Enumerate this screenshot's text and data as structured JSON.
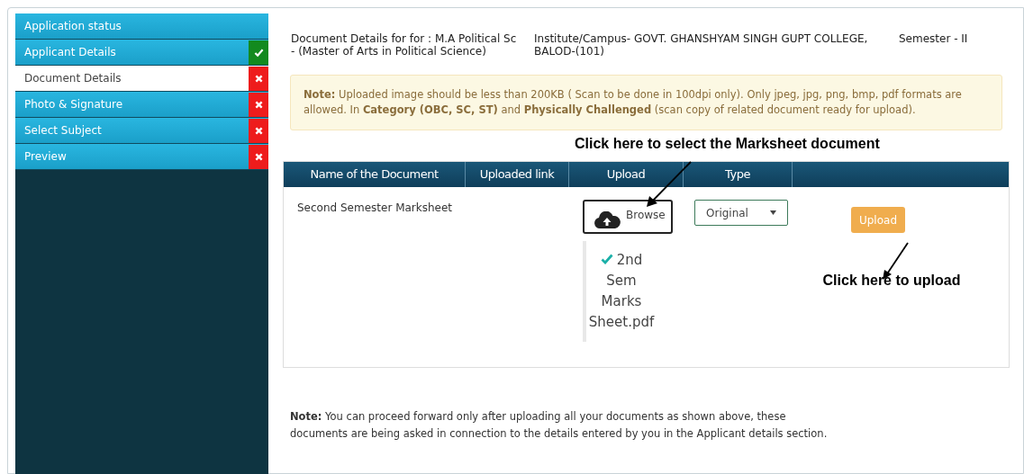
{
  "sidebar": {
    "items": [
      {
        "kind": "heading",
        "label": "Application status",
        "selected": false
      },
      {
        "kind": "step",
        "label": "Applicant Details",
        "selected": false,
        "done": true
      },
      {
        "kind": "step",
        "label": "Document Details",
        "selected": true,
        "done": false
      },
      {
        "kind": "step",
        "label": "Photo & Signature",
        "selected": false,
        "done": false
      },
      {
        "kind": "step",
        "label": "Select Subject",
        "selected": false,
        "done": false
      },
      {
        "kind": "step",
        "label": "Preview",
        "selected": false,
        "done": false
      }
    ]
  },
  "header": {
    "course": "Document Details for for : M.A Political Sc - (Master of Arts in Political Science)",
    "institute": "Institute/Campus- GOVT. GHANSHYAM SINGH GUPT COLLEGE, BALOD-(101)",
    "semester": "Semester - II"
  },
  "note": "**Note:** Uploaded image should be less than 200KB ( Scan to be done in 100dpi only). Only jpeg, jpg, png, bmp, pdf formats are allowed. In **Category (OBC, SC, ST)** and **Physically Challenged** (scan copy of related document ready for upload).",
  "annotations": {
    "select": "Click here to select the Marksheet document",
    "upload": "Click here to upload"
  },
  "table": {
    "columns": [
      "Name of the Document",
      "Uploaded link",
      "Upload",
      "Type"
    ],
    "rows": [
      {
        "name": "Second Semester Marksheet",
        "browse": "Browse",
        "file": "2nd Sem Marks Sheet.pdf",
        "file_chosen": true,
        "type": "Original",
        "upload": "Upload"
      }
    ]
  },
  "footer_note": "**Note:** You can proceed forward only after uploading all your documents as shown above, these documents are being asked in connection to the details entered by you in the Applicant details section."
}
